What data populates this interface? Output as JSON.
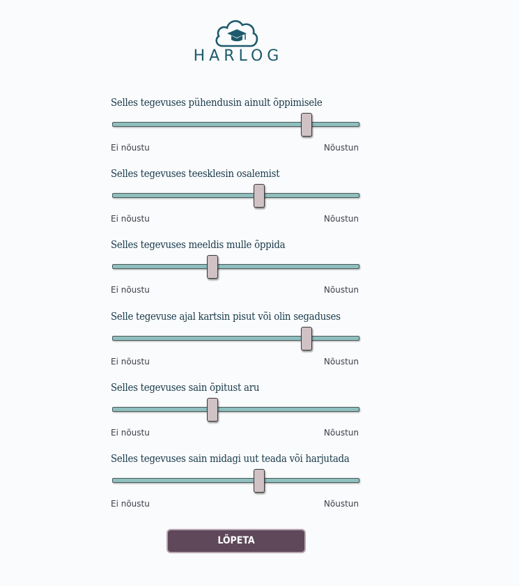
{
  "logo": {
    "text": "HARLOG",
    "icon": "cloud-graduation-cap-icon",
    "color": "#1d5a6c"
  },
  "questions": [
    {
      "label": "Selles tegevuses pühendusin ainult õppimisele",
      "value_fraction": 0.785
    },
    {
      "label": "Selles tegevuses teesklesin osalemist",
      "value_fraction": 0.595
    },
    {
      "label": "Selles tegevuses meeldis mulle õppida",
      "value_fraction": 0.405
    },
    {
      "label": "Selle tegevuse ajal kartsin pisut või olin segaduses",
      "value_fraction": 0.785
    },
    {
      "label": "Selles tegevuses sain õpitust aru",
      "value_fraction": 0.405
    },
    {
      "label": "Selles tegevuses sain midagi uut teada või harjutada",
      "value_fraction": 0.595
    }
  ],
  "scale": {
    "min_label": "Ei nõustu",
    "max_label": "Nõustun"
  },
  "finish_button": {
    "label": "LÕPETA"
  },
  "colors": {
    "track": "#8fbfbe",
    "thumb": "#cfc1c4",
    "button": "#5e4859",
    "label": "#17394a"
  }
}
